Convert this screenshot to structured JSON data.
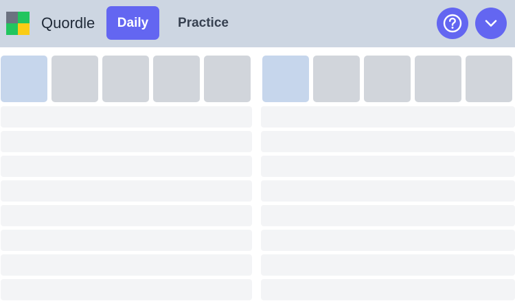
{
  "header": {
    "app_title": "Quordle",
    "tabs": [
      {
        "label": "Daily",
        "active": true
      },
      {
        "label": "Practice",
        "active": false
      }
    ],
    "buttons": {
      "help_icon": "question-circle-icon",
      "menu_icon": "chevron-down-icon"
    }
  },
  "colors": {
    "header_bg": "#cdd6e2",
    "accent": "#6366f1",
    "tile_empty": "#d1d5db",
    "tile_active": "#c6d6ec",
    "row_placeholder": "#f3f4f6",
    "logo": [
      "#6b7280",
      "#22c55e",
      "#22c55e",
      "#facc15"
    ]
  },
  "boards": [
    {
      "name": "left",
      "tiles_per_row": 5,
      "active_tile": 1,
      "placeholder_rows": 8
    },
    {
      "name": "right",
      "tiles_per_row": 5,
      "active_tile": 1,
      "placeholder_rows": 8
    }
  ]
}
